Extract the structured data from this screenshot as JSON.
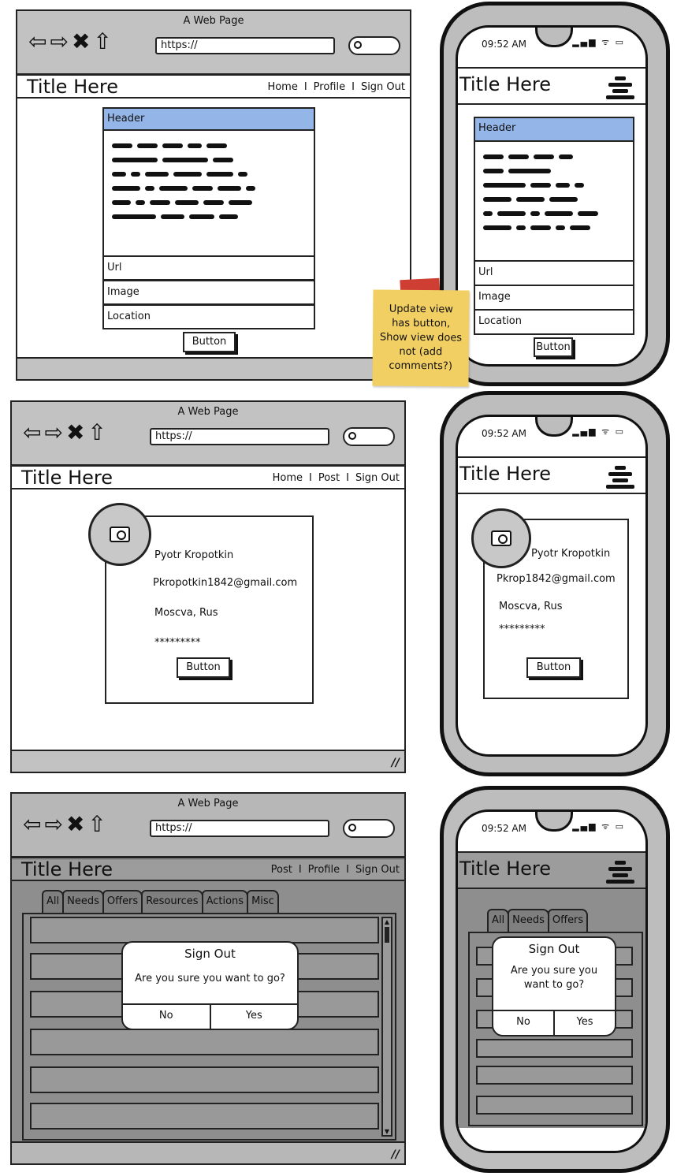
{
  "desktop_edit": {
    "window_title": "A Web Page",
    "url": "https://",
    "title": "Title Here",
    "nav": [
      "Home",
      "Profile",
      "Sign Out"
    ],
    "header": "Header",
    "fields": [
      "Url",
      "Image",
      "Location"
    ],
    "button": "Button"
  },
  "mobile_edit": {
    "time": "09:52 AM",
    "title": "Title Here",
    "header": "Header",
    "fields": [
      "Url",
      "Image",
      "Location"
    ],
    "button": "Button"
  },
  "note": "Update view has button, Show view does not (add comments?)",
  "desktop_profile": {
    "window_title": "A Web Page",
    "url": "https://",
    "title": "Title Here",
    "nav": [
      "Home",
      "Post",
      "Sign Out"
    ],
    "name": "Pyotr Kropotkin",
    "email": "Pkropotkin1842@gmail.com",
    "location": "Moscva, Rus",
    "password": "*********",
    "button": "Button"
  },
  "mobile_profile": {
    "time": "09:52 AM",
    "title": "Title Here",
    "name": "Pyotr Kropotkin",
    "email": "Pkrop1842@gmail.com",
    "location": "Moscva, Rus",
    "password": "*********",
    "button": "Button"
  },
  "desktop_signout": {
    "window_title": "A Web Page",
    "url": "https://",
    "title": "Title Here",
    "nav": [
      "Post",
      "Profile",
      "Sign Out"
    ],
    "tabs": [
      "All",
      "Needs",
      "Offers",
      "Resources",
      "Actions",
      "Misc"
    ],
    "dialog": {
      "title": "Sign Out",
      "message": "Are you sure you want to go?",
      "no": "No",
      "yes": "Yes"
    }
  },
  "mobile_signout": {
    "time": "09:52 AM",
    "title": "Title Here",
    "tabs": [
      "All",
      "Needs",
      "Offers"
    ],
    "dialog": {
      "title": "Sign Out",
      "message": "Are you sure you want to go?",
      "no": "No",
      "yes": "Yes"
    }
  }
}
